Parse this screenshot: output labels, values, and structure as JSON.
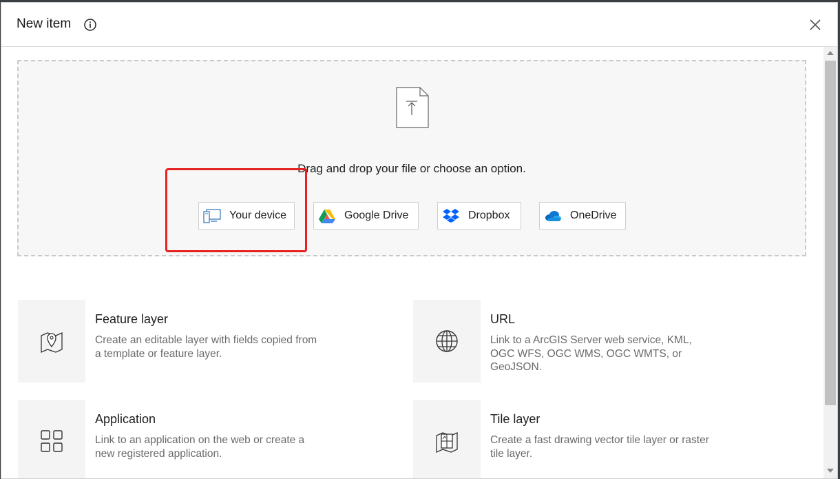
{
  "dialog": {
    "title": "New item"
  },
  "dropzone": {
    "instruction": "Drag and drop your file or choose an option.",
    "sources": [
      {
        "label": "Your device",
        "icon": "device-icon"
      },
      {
        "label": "Google Drive",
        "icon": "google-drive-icon"
      },
      {
        "label": "Dropbox",
        "icon": "dropbox-icon"
      },
      {
        "label": "OneDrive",
        "icon": "onedrive-icon"
      }
    ],
    "highlight_color": "#e52222"
  },
  "options": [
    {
      "title": "Feature layer",
      "description": "Create an editable layer with fields copied from a template or feature layer.",
      "icon": "map-pin-icon"
    },
    {
      "title": "URL",
      "description": "Link to a ArcGIS Server web service, KML, OGC WFS, OGC WMS, OGC WMTS, or GeoJSON.",
      "icon": "globe-icon"
    },
    {
      "title": "Application",
      "description": "Link to an application on the web or create a new registered application.",
      "icon": "grid-icon"
    },
    {
      "title": "Tile layer",
      "description": "Create a fast drawing vector tile layer or raster tile layer.",
      "icon": "tile-layer-icon"
    }
  ]
}
